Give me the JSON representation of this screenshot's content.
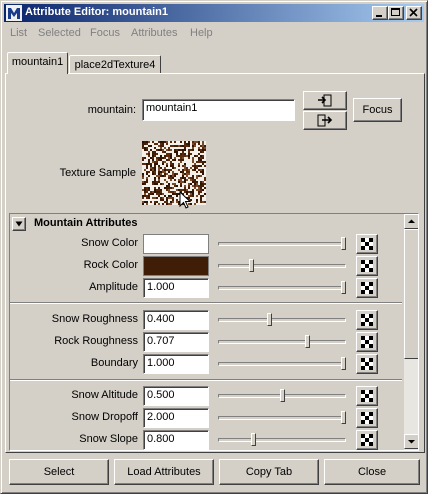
{
  "window": {
    "title": "Attribute Editor: mountain1"
  },
  "menu": [
    "List",
    "Selected",
    "Focus",
    "Attributes",
    "Help"
  ],
  "tabs": [
    {
      "label": "mountain1",
      "active": true
    },
    {
      "label": "place2dTexture4",
      "active": false
    }
  ],
  "node": {
    "label": "mountain:",
    "value": "mountain1",
    "focus_label": "Focus"
  },
  "texture_sample": {
    "label": "Texture Sample"
  },
  "section": {
    "title": "Mountain Attributes"
  },
  "attributes": [
    {
      "label": "Snow Color",
      "kind": "color",
      "color": "#ffffff",
      "slider": 1.0
    },
    {
      "label": "Rock Color",
      "kind": "color",
      "color": "#3f1d07",
      "slider": 0.25
    },
    {
      "label": "Amplitude",
      "kind": "value",
      "value": "1.000",
      "slider": 1.0
    },
    {
      "label": "Snow Roughness",
      "kind": "value",
      "value": "0.400",
      "slider": 0.4
    },
    {
      "label": "Rock Roughness",
      "kind": "value",
      "value": "0.707",
      "slider": 0.707
    },
    {
      "label": "Boundary",
      "kind": "value",
      "value": "1.000",
      "slider": 1.0
    },
    {
      "label": "Snow Altitude",
      "kind": "value",
      "value": "0.500",
      "slider": 0.5
    },
    {
      "label": "Snow Dropoff",
      "kind": "value",
      "value": "2.000",
      "slider": 1.0
    },
    {
      "label": "Snow Slope",
      "kind": "value",
      "value": "0.800",
      "slider": 0.27
    }
  ],
  "bottom_buttons": {
    "select": "Select",
    "load": "Load Attributes",
    "copy": "Copy Tab",
    "close": "Close"
  },
  "colors": {
    "titlebar_start": "#0a246a",
    "titlebar_end": "#a6caf0",
    "face": "#d4d0c8"
  },
  "icons": {
    "app": "maya-logo-icon",
    "minimize": "minimize-icon",
    "maximize": "maximize-icon",
    "close": "close-icon",
    "input_connection": "input-connection-icon",
    "output_connection": "output-connection-icon",
    "collapse": "collapse-arrow-icon",
    "map": "checker-map-icon"
  }
}
